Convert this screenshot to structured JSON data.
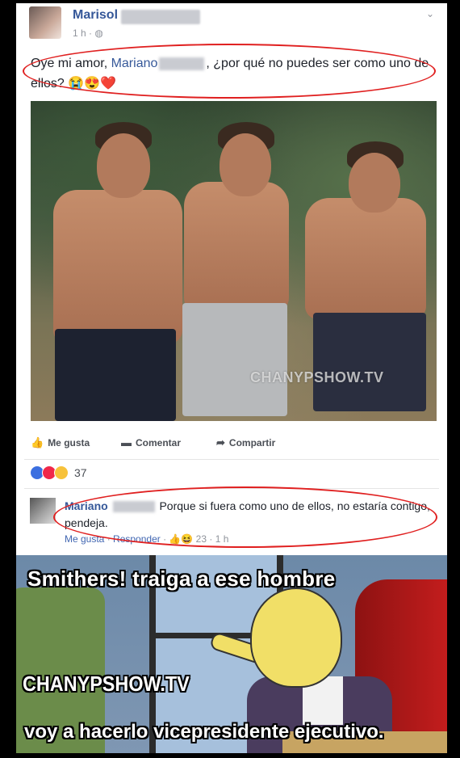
{
  "post": {
    "author": "Marisol",
    "time": "1 h · ",
    "text_part1": "Oye mi amor, ",
    "mention": "Mariano",
    "text_part2": ", ¿por qué no puedes ser como uno de ellos? ",
    "emojis": "😭😍❤️",
    "photo_watermark": "CHANYPSHOW.TV"
  },
  "actions": {
    "like": "Me gusta",
    "comment": "Comentar",
    "share": "Compartir"
  },
  "reactions": {
    "count": "37"
  },
  "comment": {
    "author": "Mariano",
    "text": "Porque si fuera como uno de ellos, no estaría contigo, pendeja.",
    "like_label": "Me gusta",
    "reply_label": "Responder",
    "reaction_count": "23",
    "time": "1 h"
  },
  "meme": {
    "top_caption": "Smithers! traiga a ese hombre",
    "watermark": "CHANYPSHOW.TV",
    "bottom_caption": "voy a hacerlo vicepresidente ejecutivo."
  },
  "colors": {
    "link_blue": "#365899",
    "highlight_red": "#e02020"
  }
}
